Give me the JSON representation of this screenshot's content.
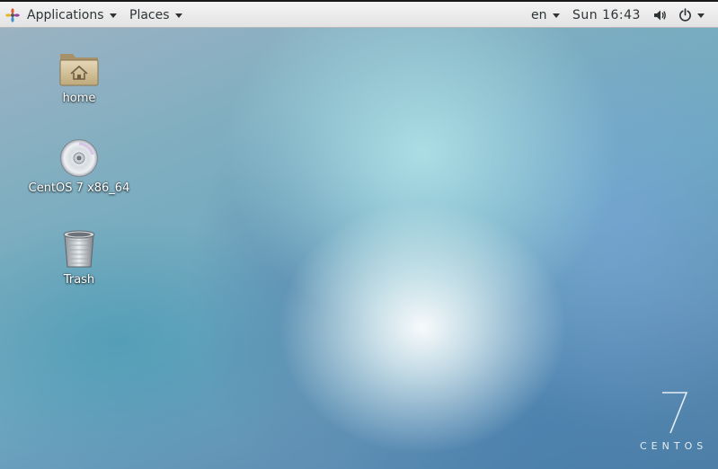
{
  "topbar": {
    "applications_label": "Applications",
    "places_label": "Places",
    "language": "en",
    "clock": "Sun 16:43",
    "icons": [
      "gnome-logo-icon",
      "volume-icon",
      "power-icon"
    ]
  },
  "desktop": {
    "icons": [
      {
        "label": "home",
        "icon": "home-folder-icon"
      },
      {
        "label": "CentOS 7 x86_64",
        "icon": "dvd-disc-icon"
      },
      {
        "label": "Trash",
        "icon": "trash-icon"
      }
    ]
  },
  "watermark": {
    "numeral": "7",
    "word": "CENTOS"
  },
  "colors": {
    "topbar_bg": "#e9e9e9",
    "topbar_text": "#2e3436",
    "wallpaper_primary": "#6fa8c0"
  }
}
